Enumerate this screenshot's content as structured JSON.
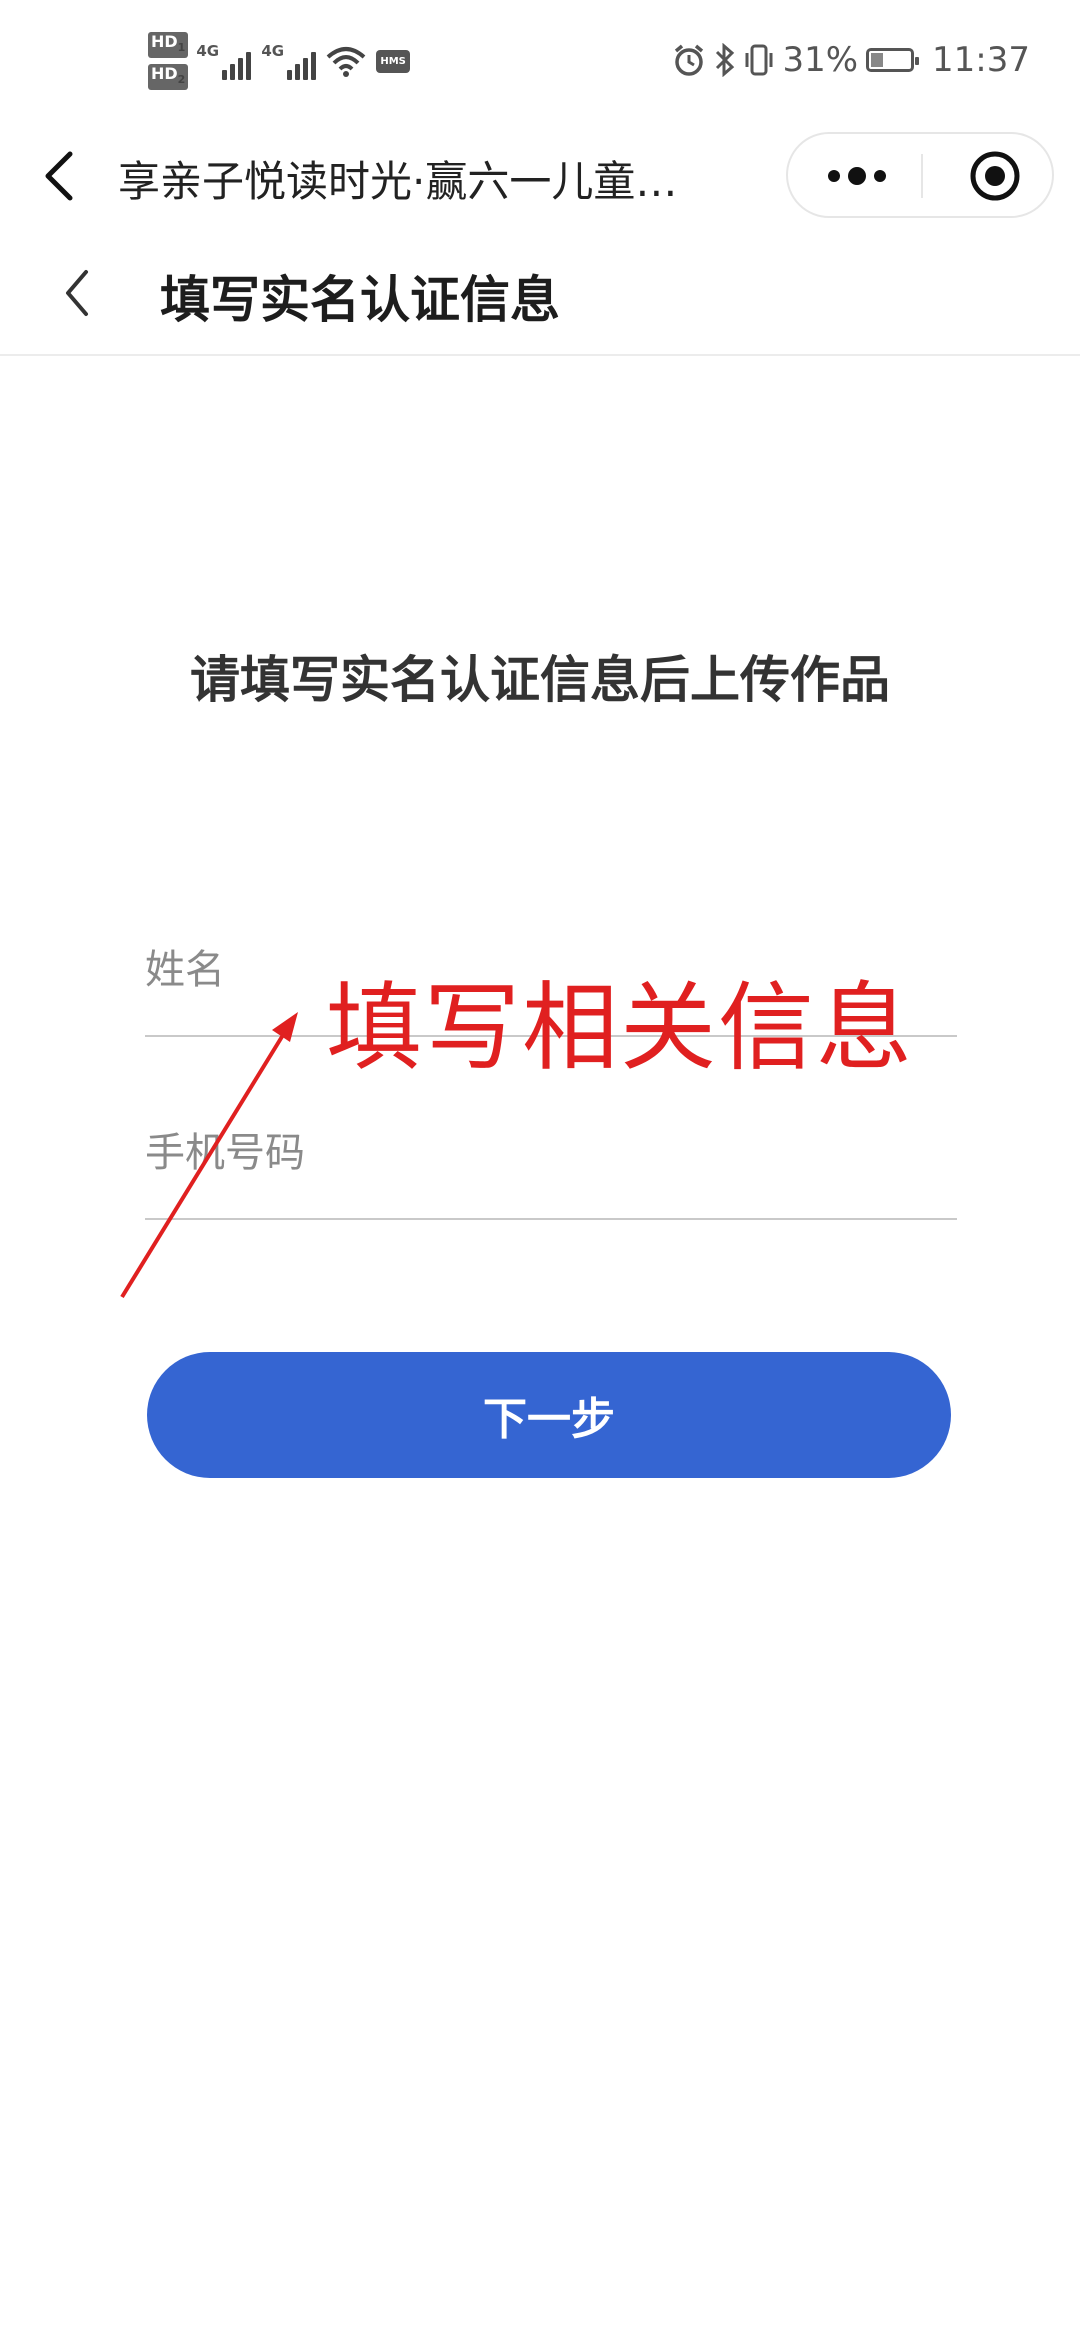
{
  "status_bar": {
    "hd1": "HD",
    "hd1_sub": "1",
    "hd2": "HD",
    "hd2_sub": "2",
    "net1": "4G",
    "net2": "4G",
    "hms": "HMS",
    "battery_percent": "31%",
    "battery_level": 0.31,
    "time": "11:37"
  },
  "miniprogram_nav": {
    "title": "享亲子悦读时光·赢六一儿童…"
  },
  "page_header": {
    "title": "填写实名认证信息"
  },
  "form": {
    "heading": "请填写实名认证信息后上传作品",
    "name_placeholder": "姓名",
    "phone_placeholder": "手机号码",
    "next_button": "下一步"
  },
  "annotation": {
    "text": "填写相关信息",
    "color": "#e02020"
  },
  "colors": {
    "primary_button": "#3565d2"
  }
}
